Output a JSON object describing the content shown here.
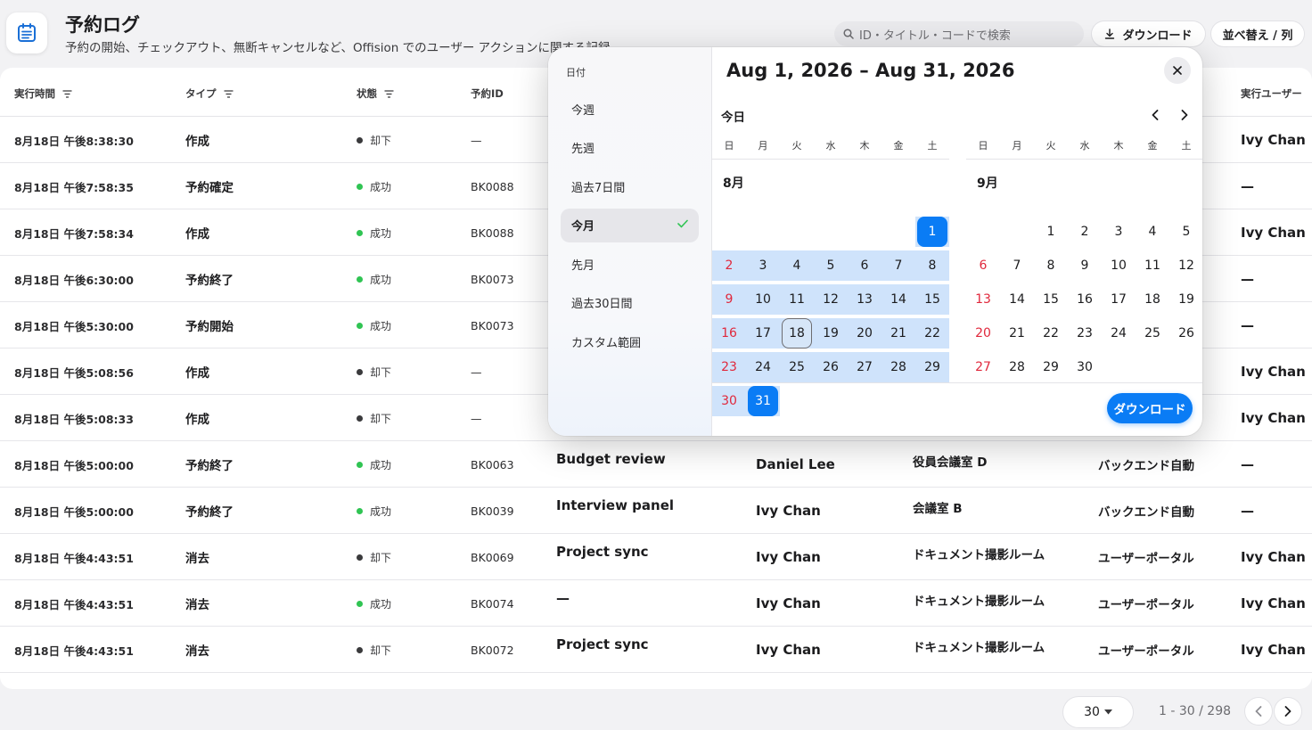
{
  "header": {
    "title": "予約ログ",
    "subtitle": "予約の開始、チェックアウト、無断キャンセルなど、Offision でのユーザー アクションに関する記録",
    "search_placeholder": "ID・タイトル・コードで検索",
    "download_label": "ダウンロード",
    "sort_label": "並べ替え / 列"
  },
  "table": {
    "columns": {
      "time": "実行時間",
      "type": "タイプ",
      "status": "状態",
      "booking_id": "予約ID",
      "executor": "実行ユーザー"
    },
    "rows": [
      {
        "time": "8月18日 午後8:38:30",
        "type": "作成",
        "status": "却下",
        "status_ok": false,
        "id": "—",
        "title": "",
        "user": "",
        "room": "",
        "source": "",
        "exec": "Ivy Chan"
      },
      {
        "time": "8月18日 午後7:58:35",
        "type": "予約確定",
        "status": "成功",
        "status_ok": true,
        "id": "BK0088",
        "title": "",
        "user": "",
        "room": "",
        "source": "",
        "exec": "—"
      },
      {
        "time": "8月18日 午後7:58:34",
        "type": "作成",
        "status": "成功",
        "status_ok": true,
        "id": "BK0088",
        "title": "",
        "user": "",
        "room": "",
        "source": "",
        "exec": "Ivy Chan"
      },
      {
        "time": "8月18日 午後6:30:00",
        "type": "予約終了",
        "status": "成功",
        "status_ok": true,
        "id": "BK0073",
        "title": "",
        "user": "",
        "room": "",
        "source": "",
        "exec": "—"
      },
      {
        "time": "8月18日 午後5:30:00",
        "type": "予約開始",
        "status": "成功",
        "status_ok": true,
        "id": "BK0073",
        "title": "",
        "user": "",
        "room": "",
        "source": "",
        "exec": "—"
      },
      {
        "time": "8月18日 午後5:08:56",
        "type": "作成",
        "status": "却下",
        "status_ok": false,
        "id": "—",
        "title": "",
        "user": "",
        "room": "",
        "source": "",
        "exec": "Ivy Chan"
      },
      {
        "time": "8月18日 午後5:08:33",
        "type": "作成",
        "status": "却下",
        "status_ok": false,
        "id": "—",
        "title": "",
        "user": "",
        "room": "",
        "source": "",
        "exec": "Ivy Chan"
      },
      {
        "time": "8月18日 午後5:00:00",
        "type": "予約終了",
        "status": "成功",
        "status_ok": true,
        "id": "BK0063",
        "title": "Budget review",
        "user": "Daniel Lee",
        "room": "役員会議室 D",
        "source": "バックエンド自動",
        "exec": "—"
      },
      {
        "time": "8月18日 午後5:00:00",
        "type": "予約終了",
        "status": "成功",
        "status_ok": true,
        "id": "BK0039",
        "title": "Interview panel",
        "user": "Ivy Chan",
        "room": "会議室 B",
        "source": "バックエンド自動",
        "exec": "—"
      },
      {
        "time": "8月18日 午後4:43:51",
        "type": "消去",
        "status": "却下",
        "status_ok": false,
        "id": "BK0069",
        "title": "Project sync",
        "user": "Ivy Chan",
        "room": "ドキュメント撮影ルーム",
        "source": "ユーザーポータル",
        "exec": "Ivy Chan"
      },
      {
        "time": "8月18日 午後4:43:51",
        "type": "消去",
        "status": "成功",
        "status_ok": true,
        "id": "BK0074",
        "title": "—",
        "user": "Ivy Chan",
        "room": "ドキュメント撮影ルーム",
        "source": "ユーザーポータル",
        "exec": "Ivy Chan"
      },
      {
        "time": "8月18日 午後4:43:51",
        "type": "消去",
        "status": "却下",
        "status_ok": false,
        "id": "BK0072",
        "title": "Project sync",
        "user": "Ivy Chan",
        "room": "ドキュメント撮影ルーム",
        "source": "ユーザーポータル",
        "exec": "Ivy Chan"
      }
    ]
  },
  "pagination": {
    "page_size": "30",
    "range": "1 - 30 / 298"
  },
  "date_picker": {
    "preset_heading": "日付",
    "presets": [
      {
        "label": "今週",
        "active": false
      },
      {
        "label": "先週",
        "active": false
      },
      {
        "label": "過去7日間",
        "active": false
      },
      {
        "label": "今月",
        "active": true
      },
      {
        "label": "先月",
        "active": false
      },
      {
        "label": "過去30日間",
        "active": false
      },
      {
        "label": "カスタム範囲",
        "active": false
      }
    ],
    "range_title": "Aug 1, 2026 – Aug 31, 2026",
    "today_label": "今日",
    "weekdays": [
      "日",
      "月",
      "火",
      "水",
      "木",
      "金",
      "土"
    ],
    "months": [
      {
        "label": "8月",
        "first_weekday": 6,
        "days": 31,
        "range_start": 1,
        "range_end": 31,
        "today": 18
      },
      {
        "label": "9月",
        "first_weekday": 2,
        "days": 30,
        "range_start": 0,
        "range_end": 0,
        "today": 0
      }
    ],
    "download_label": "ダウンロード"
  },
  "colors": {
    "accent": "#0a7cf5",
    "range_fill": "#cfe3fb",
    "success": "#30c453",
    "sunday": "#e0283c"
  }
}
